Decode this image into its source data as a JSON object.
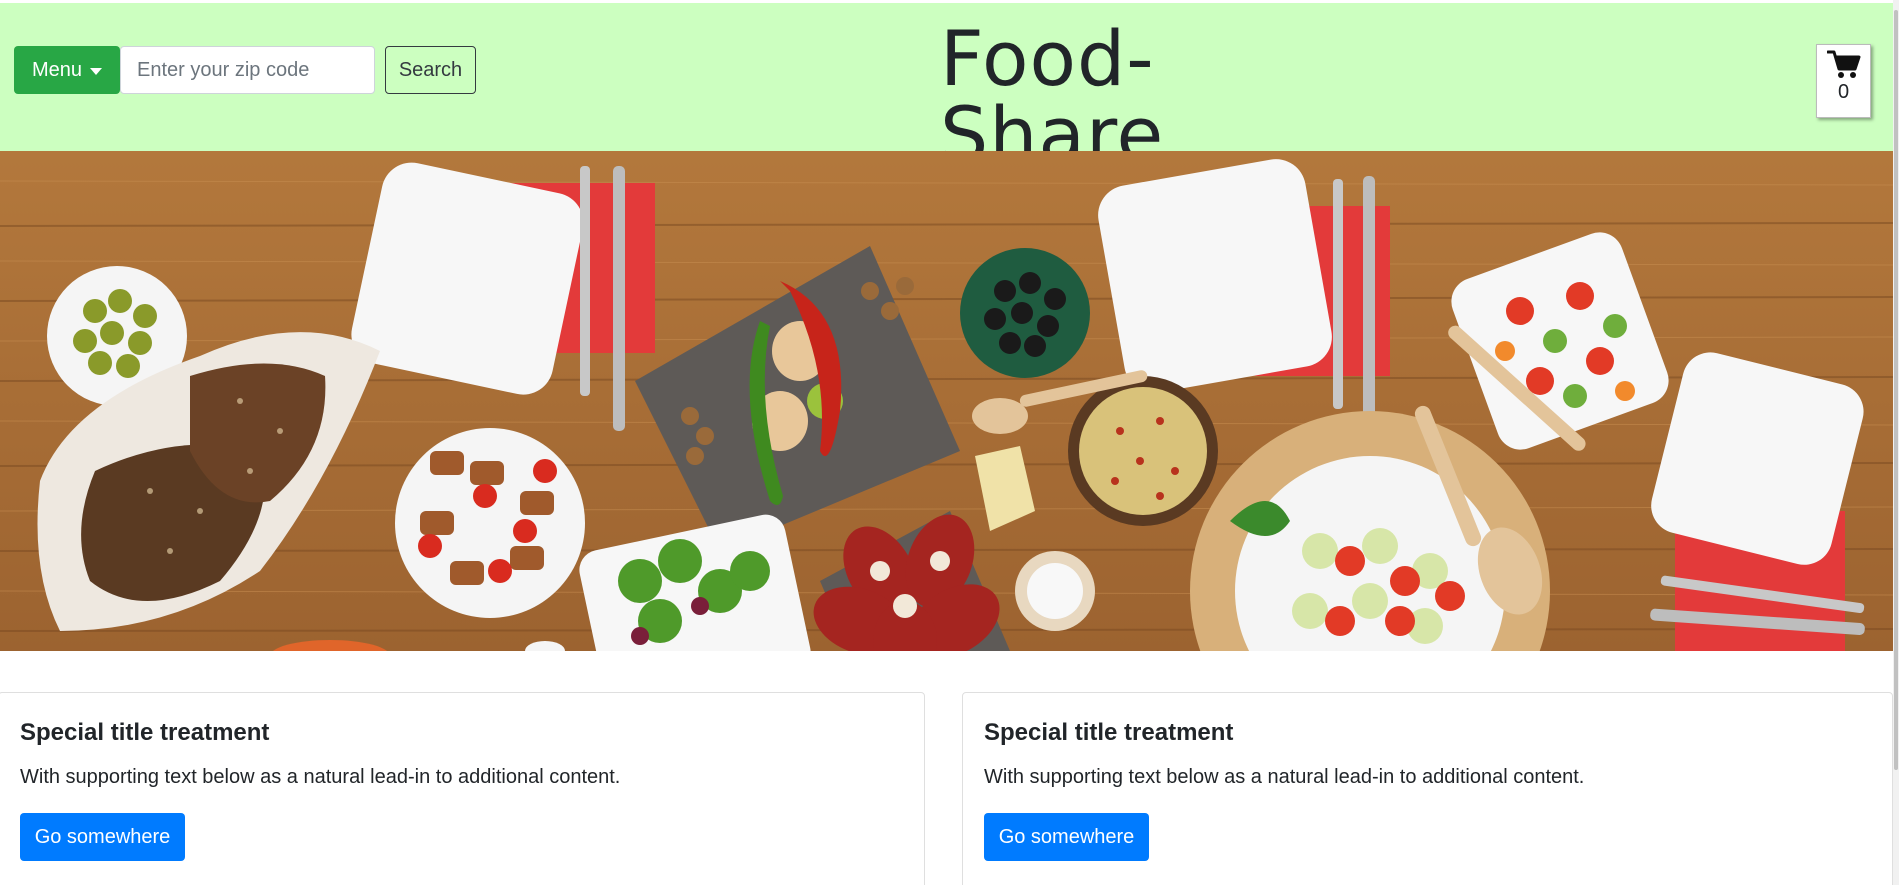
{
  "header": {
    "menu_label": "Menu",
    "zip_placeholder": "Enter your zip code",
    "search_label": "Search",
    "site_title": "Food-Share",
    "cart_count": "0"
  },
  "cards": [
    {
      "title": "Special title treatment",
      "text": "With supporting text below as a natural lead-in to additional content.",
      "button": "Go somewhere"
    },
    {
      "title": "Special title treatment",
      "text": "With supporting text below as a natural lead-in to additional content.",
      "button": "Go somewhere"
    }
  ],
  "colors": {
    "header_bg": "#ccffc0",
    "menu_green": "#28a745",
    "primary_blue": "#007bff",
    "wood": "#b0773c"
  },
  "icons": [
    "caret-down-icon",
    "cart-icon"
  ]
}
